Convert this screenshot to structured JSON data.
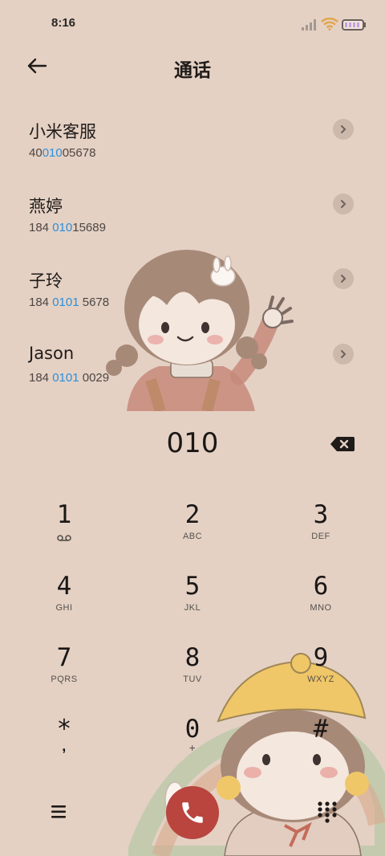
{
  "status": {
    "time": "8:16"
  },
  "header": {
    "title": "通话"
  },
  "contacts": [
    {
      "name": "小米客服",
      "num_pre": "40",
      "num_hl": "010",
      "num_post": "05678"
    },
    {
      "name": "燕婷",
      "num_pre": "184 ",
      "num_hl": "010",
      "num_post": "15689"
    },
    {
      "name": "子玲",
      "num_pre": "184 ",
      "num_hl": "0101",
      "num_post": " 5678"
    },
    {
      "name": "Jason",
      "num_pre": "184 ",
      "num_hl": "0101",
      "num_post": " 0029"
    }
  ],
  "dialer": {
    "number": "010"
  },
  "keys": [
    {
      "digit": "1",
      "sub": ""
    },
    {
      "digit": "2",
      "sub": "ABC"
    },
    {
      "digit": "3",
      "sub": "DEF"
    },
    {
      "digit": "4",
      "sub": "GHI"
    },
    {
      "digit": "5",
      "sub": "JKL"
    },
    {
      "digit": "6",
      "sub": "MNO"
    },
    {
      "digit": "7",
      "sub": "PQRS"
    },
    {
      "digit": "8",
      "sub": "TUV"
    },
    {
      "digit": "9",
      "sub": "WXYZ"
    },
    {
      "digit": "*",
      "sub": ","
    },
    {
      "digit": "0",
      "sub": "+"
    },
    {
      "digit": "#",
      "sub": ""
    }
  ],
  "icons": {
    "back": "arrow-left-icon",
    "chevron": "chevron-right-icon",
    "backspace": "backspace-icon",
    "voicemail": "voicemail-icon",
    "menu": "menu-icon",
    "call": "phone-icon",
    "dialpad": "dialpad-icon"
  },
  "colors": {
    "background": "#e4d1c4",
    "highlight": "#2b8fdc",
    "call": "#b9453e"
  }
}
